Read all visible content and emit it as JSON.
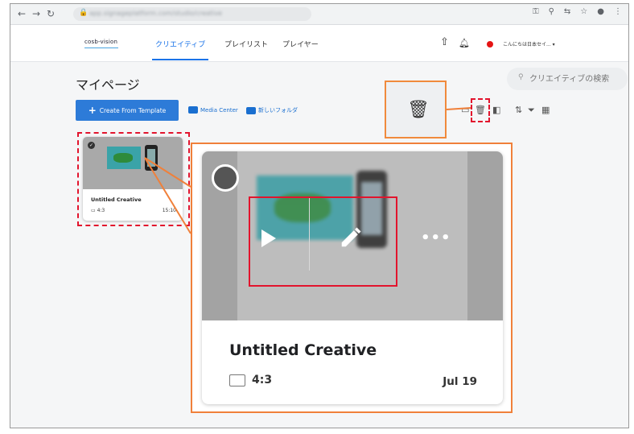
{
  "browser": {
    "url": "app.signageplatform.com/studio/creative",
    "icons": [
      "key-icon",
      "zoom-icon",
      "translate-icon",
      "star-icon",
      "profile-icon",
      "menu-icon"
    ]
  },
  "appbar": {
    "logo": "cosb-vision",
    "tabs": [
      {
        "label": "クリエイティブ",
        "active": true
      },
      {
        "label": "プレイリスト",
        "active": false
      },
      {
        "label": "プレイヤー",
        "active": false
      }
    ],
    "user": "こんにちは日本セイ... ▾"
  },
  "page": {
    "title": "マイページ",
    "search_placeholder": "クリエイティブの検索",
    "create_button": "Create From Template",
    "media_center": "Media Center",
    "new_folder": "新しいフォルダ"
  },
  "small_card": {
    "title": "Untitled Creative",
    "ratio": "4:3",
    "time": "15:10"
  },
  "big_card": {
    "title": "Untitled Creative",
    "ratio": "4:3",
    "date": "Jul 19",
    "more": "•••"
  },
  "colors": {
    "primary": "#2d7bd8",
    "highlight_orange": "#f0803a",
    "highlight_red": "#e2142d",
    "record_dot": "#e51414"
  }
}
